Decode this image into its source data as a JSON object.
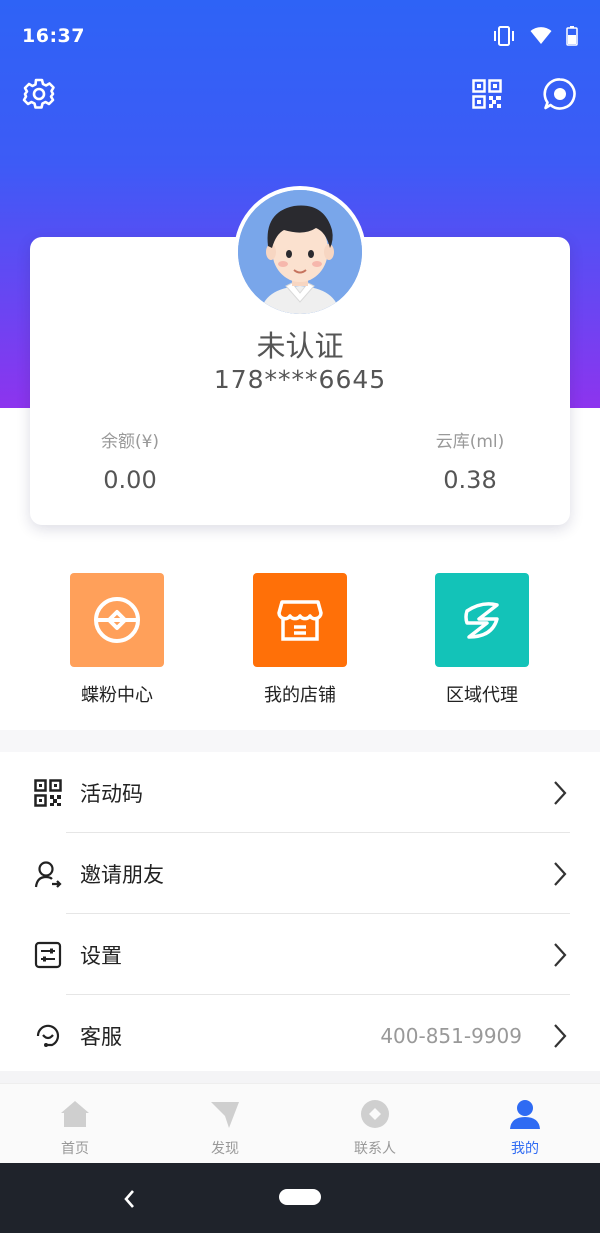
{
  "status_bar": {
    "time": "16:37"
  },
  "profile": {
    "status": "未认证",
    "phone": "178****6645",
    "balance_label": "余额(¥)",
    "balance_value": "0.00",
    "cloud_label": "云库(ml)",
    "cloud_value": "0.38"
  },
  "quick_actions": [
    {
      "label": "蝶粉中心",
      "color": "#ffa05a",
      "icon": "coin-exchange-icon"
    },
    {
      "label": "我的店铺",
      "color": "#ff7008",
      "icon": "store-icon"
    },
    {
      "label": "区域代理",
      "color": "#13c3b8",
      "icon": "agent-leaf-icon"
    }
  ],
  "menu": [
    {
      "label": "活动码",
      "value": "",
      "icon": "qr-code-icon"
    },
    {
      "label": "邀请朋友",
      "value": "",
      "icon": "invite-user-icon"
    },
    {
      "label": "设置",
      "value": "",
      "icon": "settings-sliders-icon"
    },
    {
      "label": "客服",
      "value": "400-851-9909",
      "icon": "customer-service-icon"
    }
  ],
  "tabs": [
    {
      "label": "首页",
      "icon": "home-icon",
      "active": false
    },
    {
      "label": "发现",
      "icon": "discover-icon",
      "active": false
    },
    {
      "label": "联系人",
      "icon": "contacts-icon",
      "active": false
    },
    {
      "label": "我的",
      "icon": "me-icon",
      "active": true
    }
  ],
  "colors": {
    "header_top": "#2e63f6",
    "header_bottom": "#8d34ee",
    "accent": "#2f6bf3",
    "nav_bar": "#1f232b"
  }
}
